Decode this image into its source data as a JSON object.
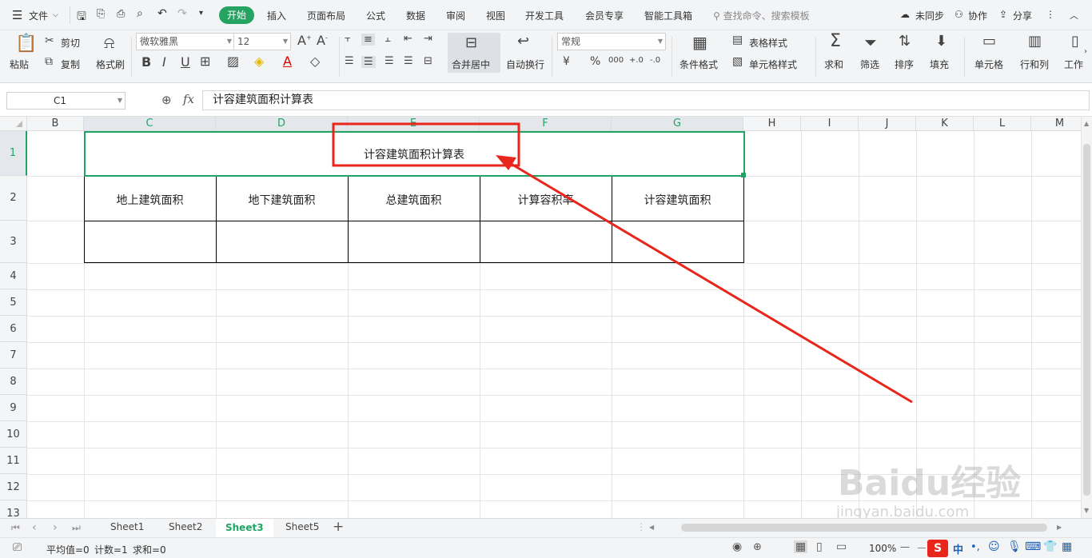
{
  "menubar": {
    "file": "文件",
    "tabs": [
      "开始",
      "插入",
      "页面布局",
      "公式",
      "数据",
      "审阅",
      "视图",
      "开发工具",
      "会员专享",
      "智能工具箱"
    ],
    "search_placeholder": "查找命令、搜索模板",
    "sync": "未同步",
    "collab": "协作",
    "share": "分享"
  },
  "ribbon": {
    "paste": "粘贴",
    "cut": "剪切",
    "copy": "复制",
    "format_painter": "格式刷",
    "font_name": "微软雅黑",
    "font_size": "12",
    "merge_center": "合并居中",
    "wrap_text": "自动换行",
    "number_format": "常规",
    "conditional_format": "条件格式",
    "table_style": "表格样式",
    "cell_style": "单元格样式",
    "sum": "求和",
    "filter": "筛选",
    "sort": "排序",
    "fill": "填充",
    "cells": "单元格",
    "rows_cols": "行和列",
    "worksheet": "工作"
  },
  "formula_bar": {
    "cell_ref": "C1",
    "fx": "fx",
    "content": "计容建筑面积计算表"
  },
  "columns": [
    "B",
    "C",
    "D",
    "E",
    "F",
    "G",
    "H",
    "I",
    "J",
    "K",
    "L",
    "M"
  ],
  "rows": [
    "1",
    "2",
    "3",
    "4",
    "5",
    "6",
    "7",
    "8",
    "9",
    "10",
    "11",
    "12",
    "13"
  ],
  "table": {
    "title": "计容建筑面积计算表",
    "headers": [
      "地上建筑面积",
      "地下建筑面积",
      "总建筑面积",
      "计算容积率",
      "计容建筑面积"
    ]
  },
  "sheets": [
    "Sheet1",
    "Sheet2",
    "Sheet3",
    "Sheet5"
  ],
  "active_sheet": "Sheet3",
  "status": {
    "average": "平均值=0",
    "count": "计数=1",
    "sum": "求和=0",
    "zoom": "100%"
  },
  "colors": {
    "accent": "#25a360",
    "annotation": "#e8261c"
  },
  "watermark": "Baidu经验 jingyan.baidu.com"
}
